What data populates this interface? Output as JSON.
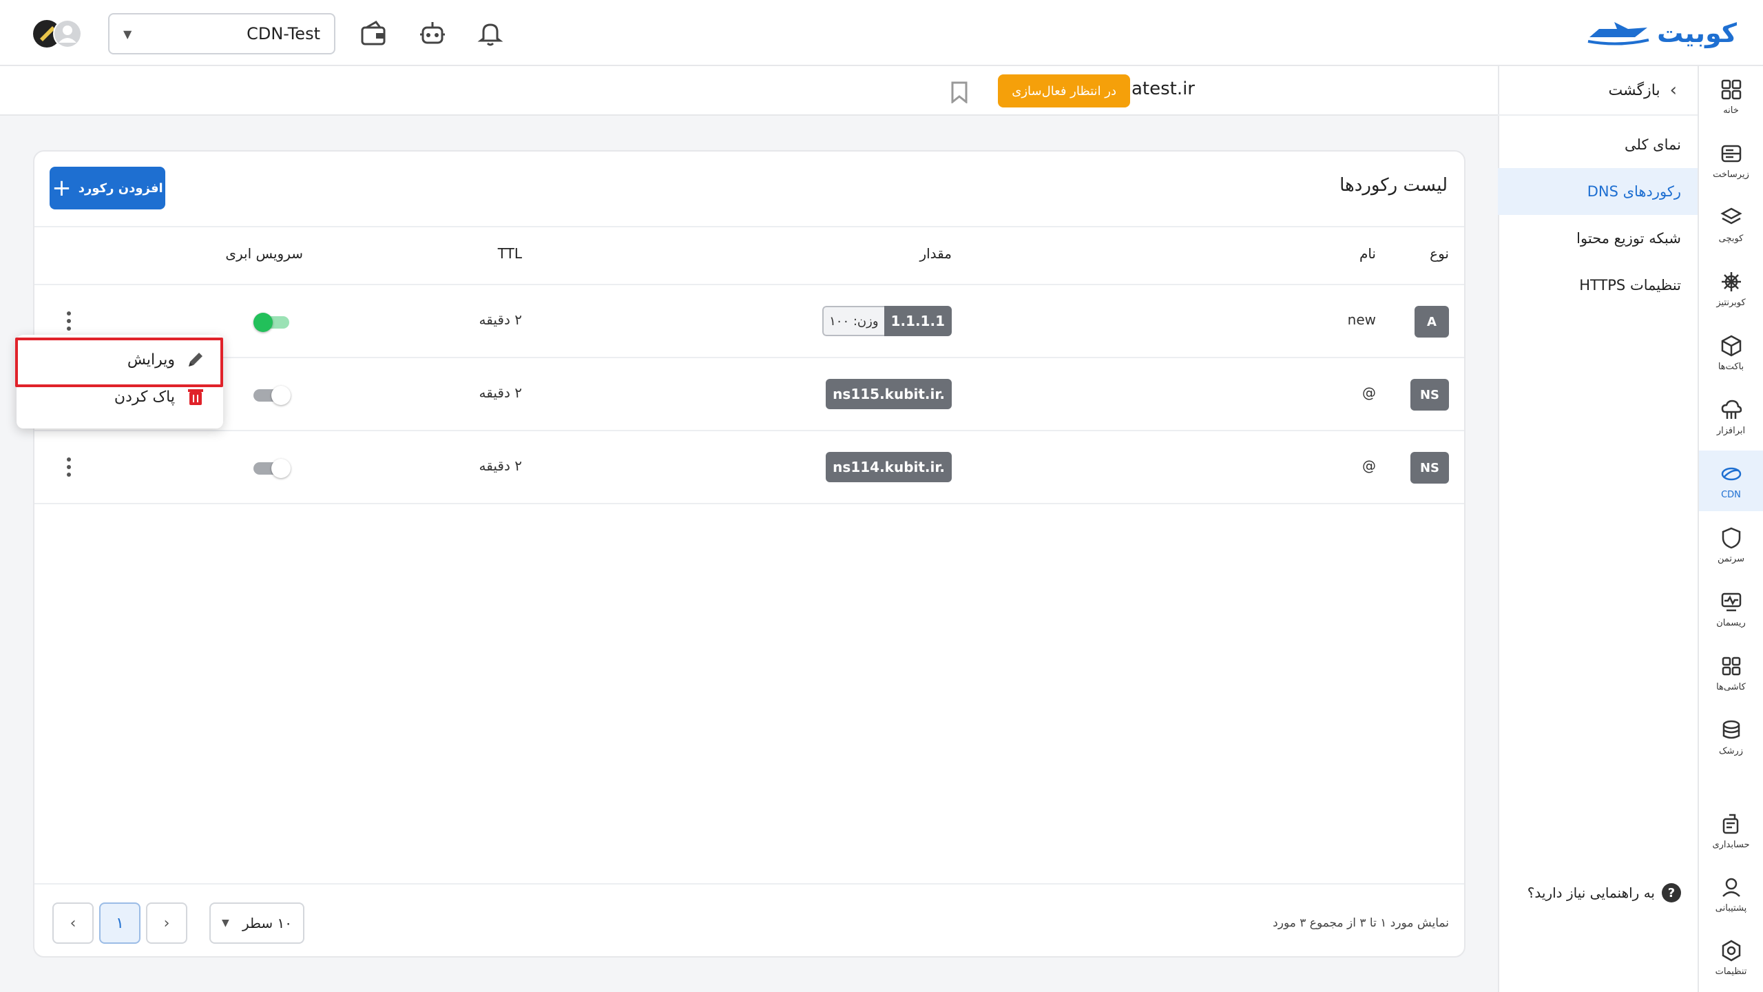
{
  "brand": {
    "name": "کوبیت",
    "color": "#1e6fd1"
  },
  "topbar": {
    "project_select": "CDN-Test",
    "icons": [
      "wallet-icon",
      "robot-icon",
      "bell-icon"
    ]
  },
  "rail": {
    "items": [
      {
        "label": "خانه",
        "icon": "home-icon"
      },
      {
        "label": "زیرساخت",
        "icon": "server-icon"
      },
      {
        "label": "کوبچی",
        "icon": "layers-icon"
      },
      {
        "label": "کوبرنتیز",
        "icon": "helm-icon"
      },
      {
        "label": "باکت‌ها",
        "icon": "box-icon"
      },
      {
        "label": "ابرافزار",
        "icon": "cloud-app-icon"
      },
      {
        "label": "CDN",
        "icon": "cdn-icon",
        "active": true
      },
      {
        "label": "سرتمن",
        "icon": "shield-icon"
      },
      {
        "label": "ریسمان",
        "icon": "monitor-icon"
      },
      {
        "label": "کاشی‌ها",
        "icon": "grid-icon"
      },
      {
        "label": "زرشک",
        "icon": "stack-icon"
      },
      {
        "label": "حسابداری",
        "icon": "accounting-icon"
      },
      {
        "label": "پشتیبانی",
        "icon": "support-icon"
      },
      {
        "label": "تنظیمات",
        "icon": "settings-icon"
      }
    ]
  },
  "subnav": {
    "back": "بازگشت",
    "items": [
      {
        "label": "نمای کلی"
      },
      {
        "label": "رکوردهای DNS",
        "active": true
      },
      {
        "label": "شبکه توزیع محتوا"
      },
      {
        "label": "تنظیمات HTTPS"
      }
    ],
    "help": "به راهنمایی نیاز دارید؟"
  },
  "header": {
    "domain": "atest.ir",
    "status_badge": "در انتظار فعال‌سازی",
    "status_color": "#f5a00a"
  },
  "records": {
    "title": "لیست رکوردها",
    "add_button": "افزودن رکورد",
    "columns": {
      "type": "نوع",
      "name": "نام",
      "value": "مقدار",
      "ttl": "TTL",
      "cloud": "سرویس ابری"
    },
    "rows": [
      {
        "type": "A",
        "name": "new",
        "value": "1.1.1.1",
        "weight": "وزن: ۱۰۰",
        "ttl": "۲ دقیقه",
        "cloud": true
      },
      {
        "type": "NS",
        "name": "@",
        "value": "ns115.kubit.ir.",
        "weight": "",
        "ttl": "۲ دقیقه",
        "cloud": false
      },
      {
        "type": "NS",
        "name": "@",
        "value": "ns114.kubit.ir.",
        "weight": "",
        "ttl": "۲ دقیقه",
        "cloud": false
      }
    ]
  },
  "context_menu": {
    "edit": "ویرایش",
    "delete": "پاک کردن"
  },
  "footer": {
    "rows_per_page": "۱۰ سطر",
    "current_page": "۱",
    "info": "نمایش مورد ۱ تا ۳ از مجموع ۳ مورد"
  }
}
